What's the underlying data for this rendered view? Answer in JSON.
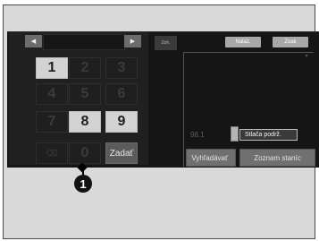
{
  "tuner": {
    "prev_arrow": "◀",
    "next_arrow": "▶",
    "frequency_value": ""
  },
  "keypad": {
    "keys": [
      "1",
      "2",
      "3",
      "4",
      "5",
      "6",
      "7",
      "8",
      "9"
    ],
    "delete_icon": "⌫",
    "zero": "0",
    "enter_label": "Zadať"
  },
  "controls": {
    "small_button_label": "Zoh.",
    "top_button_1": "Nalaz.",
    "top_button_2": "Zoak",
    "scroll_hint": "▾",
    "frequency_readout": "98.1",
    "tooltip": "Stlača podrž.",
    "bottom_left": "Vyhľadávať",
    "bottom_right": "Zoznam staníc"
  },
  "callout": {
    "number": "1"
  },
  "colors": {
    "screen_bg": "#151515",
    "active_key": "#d3d3d3",
    "dim_key": "#1f1f1f",
    "button_gray": "#707070"
  }
}
